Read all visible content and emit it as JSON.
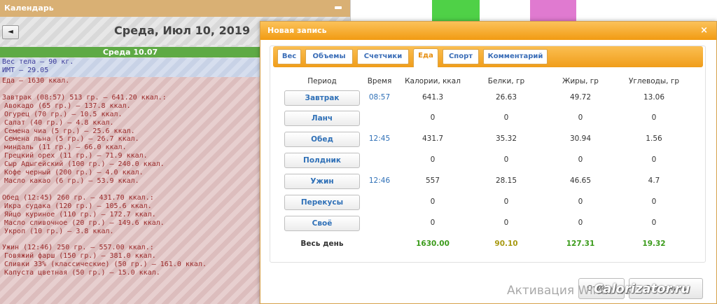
{
  "calendar": {
    "header_title": "Календарь",
    "nav_prev_glyph": "◄",
    "date_title": "Среда, Июл 10, 2019",
    "day_bar": "Среда 10.07",
    "stats": [
      "Вес тела — 90 кг.",
      "ИМТ — 29.05"
    ],
    "food_total": "Еда — 1630 ккал.",
    "meals": [
      {
        "title": "Завтрак (08:57) 513 гр. — 641.20 ккал.:",
        "items": [
          "Авокадо (65 гр.) — 137.8 ккал.",
          "Огурец (70 гр.) — 10.5 ккал.",
          "Салат (40 гр.) — 4.8 ккал.",
          "Семена чиа (5 гр.) — 25.6 ккал.",
          "Семена льна (5 гр.) — 26.7 ккал.",
          "миндаль (11 гр.) — 66.0 ккал.",
          "Грецкий орех (11 гр.) — 71.9 ккал.",
          "Сыр Адыгейский (100 гр.) — 240.0 ккал.",
          "Кофе черный (200 гр.) — 4.0 ккал.",
          "Масло какао (6 гр.) — 53.9 ккал."
        ]
      },
      {
        "title": "Обед (12:45) 260 гр. — 431.70 ккал.:",
        "items": [
          "Икра судака (120 гр.) — 105.6 ккал.",
          "Яйцо куриное (110 гр.) — 172.7 ккал.",
          "Масло сливочное (20 гр.) — 149.6 ккал.",
          "Укроп (10 гр.) — 3.8 ккал."
        ]
      },
      {
        "title": "Ужин (12:46) 250 гр. — 557.00 ккал.:",
        "items": [
          "Говяжий фарш (150 гр.) — 381.0 ккал.",
          "Сливки 33% (классические) (50 гр.) — 161.0 ккал.",
          "Капуста цветная (50 гр.) — 15.0 ккал."
        ]
      }
    ]
  },
  "modal": {
    "title": "Новая запись",
    "close_glyph": "×",
    "tabs": [
      "Вес",
      "Объемы",
      "Счетчики",
      "Еда",
      "Спорт",
      "Комментарий"
    ],
    "active_tab": "Еда",
    "table": {
      "headers": [
        "Период",
        "Время",
        "Калории, ккал",
        "Белки, гр",
        "Жиры, гр",
        "Углеводы, гр"
      ],
      "rows": [
        {
          "period": "Завтрак",
          "time": "08:57",
          "cal": "641.3",
          "protein": "26.63",
          "fat": "49.72",
          "carbs": "13.06"
        },
        {
          "period": "Ланч",
          "time": "",
          "cal": "0",
          "protein": "0",
          "fat": "0",
          "carbs": "0"
        },
        {
          "period": "Обед",
          "time": "12:45",
          "cal": "431.7",
          "protein": "35.32",
          "fat": "30.94",
          "carbs": "1.56"
        },
        {
          "period": "Полдник",
          "time": "",
          "cal": "0",
          "protein": "0",
          "fat": "0",
          "carbs": "0"
        },
        {
          "period": "Ужин",
          "time": "12:46",
          "cal": "557",
          "protein": "28.15",
          "fat": "46.65",
          "carbs": "4.7"
        },
        {
          "period": "Перекусы",
          "time": "",
          "cal": "0",
          "protein": "0",
          "fat": "0",
          "carbs": "0"
        },
        {
          "period": "Своё",
          "time": "",
          "cal": "0",
          "protein": "0",
          "fat": "0",
          "carbs": "0"
        }
      ],
      "totals": {
        "label": "Весь день",
        "cal": "1630.00",
        "protein": "90.10",
        "fat": "127.31",
        "carbs": "19.32"
      }
    },
    "footer_buttons": [
      "Отмена",
      "Сохранить"
    ]
  },
  "watermark": {
    "text": "Активация Windows"
  },
  "colors": {
    "total_cal": "#3b9b1b",
    "total_protein": "#a89a12",
    "total_fat": "#3b9b1b",
    "total_carbs": "#3b9b1b",
    "accent": "#f29b12"
  }
}
